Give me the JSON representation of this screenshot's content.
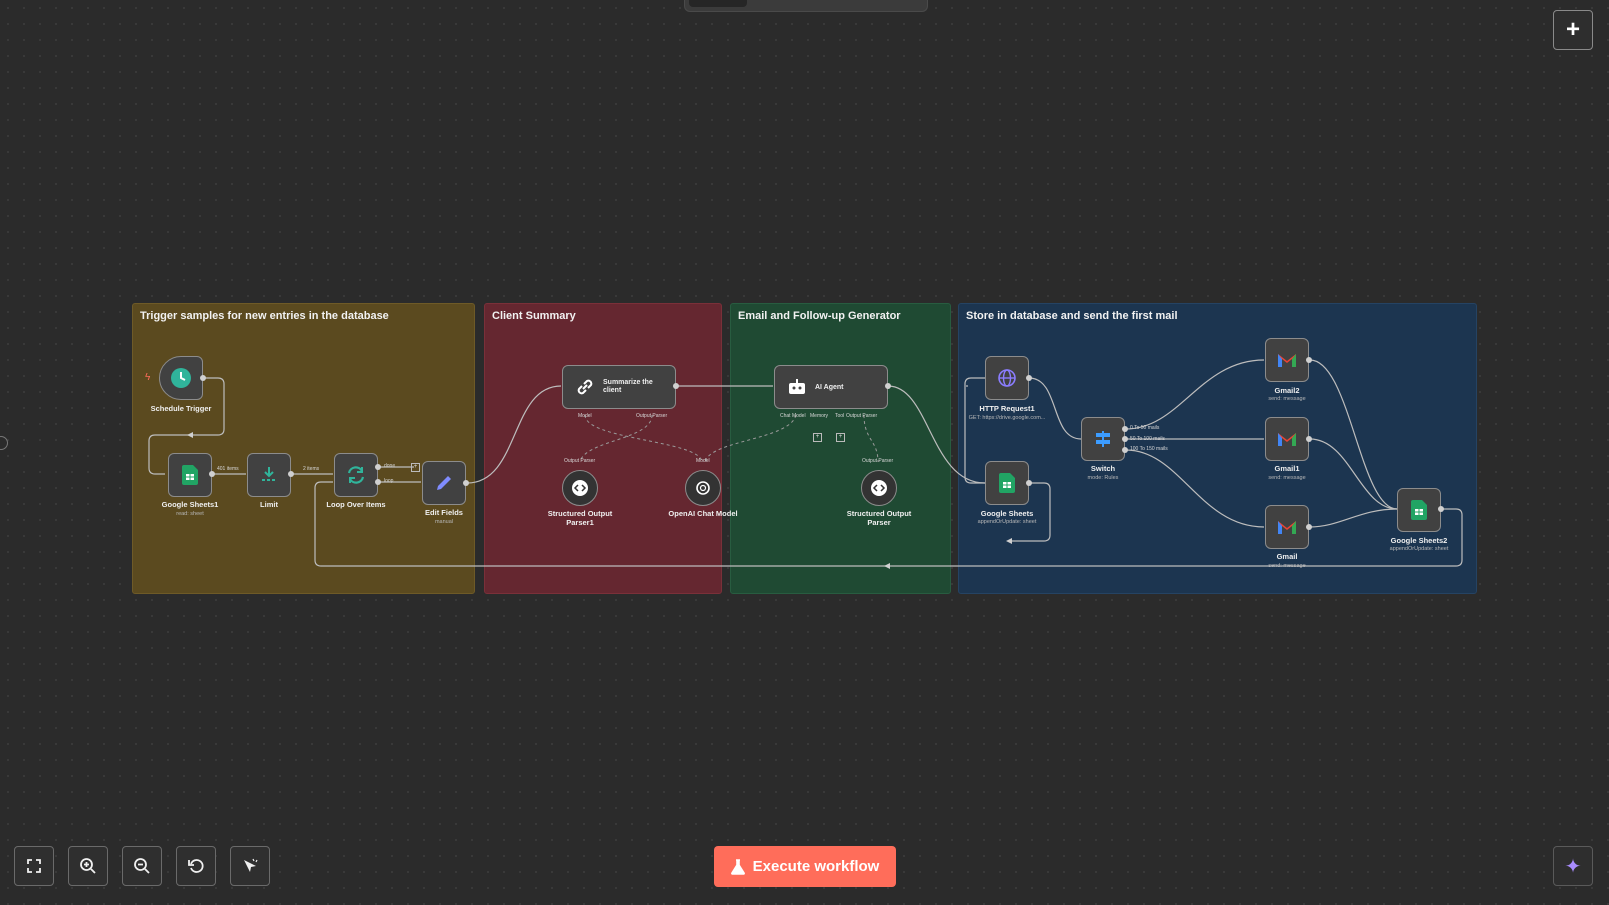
{
  "groups": {
    "g1": "Trigger samples for new entries in the database",
    "g2": "Client Summary",
    "g3": "Email and Follow-up Generator",
    "g4": "Store in database and send the first mail"
  },
  "nodes": {
    "schedule_trigger": {
      "label": "Schedule Trigger"
    },
    "google_sheets1": {
      "label": "Google Sheets1",
      "sub": "read: sheet"
    },
    "limit": {
      "label": "Limit"
    },
    "loop_over_items": {
      "label": "Loop Over Items"
    },
    "edit_fields": {
      "label": "Edit Fields",
      "sub": "manual"
    },
    "summarize_client": {
      "label": "Summarize the client"
    },
    "structured_parser1": {
      "label": "Structured Output Parser1"
    },
    "openai_chat": {
      "label": "OpenAI Chat Model"
    },
    "ai_agent": {
      "label": "AI Agent"
    },
    "structured_parser": {
      "label": "Structured Output Parser"
    },
    "http_request1": {
      "label": "HTTP Request1",
      "sub": "GET: https://drive.google.com..."
    },
    "google_sheets": {
      "label": "Google Sheets",
      "sub": "appendOrUpdate: sheet"
    },
    "switch": {
      "label": "Switch",
      "sub": "mode: Rules"
    },
    "gmail2": {
      "label": "Gmail2",
      "sub": "send: message"
    },
    "gmail1": {
      "label": "Gmail1",
      "sub": "send: message"
    },
    "gmail": {
      "label": "Gmail",
      "sub": "send: message"
    },
    "google_sheets2": {
      "label": "Google Sheets2",
      "sub": "appendOrUpdate: sheet"
    }
  },
  "edge_labels": {
    "items_401": "401 items",
    "items_2": "2 items",
    "done": "done",
    "loop": "loop",
    "model_a": "Model",
    "output_parser_a": "Output Parser",
    "output_parser_b": "Output Parser",
    "model_b": "Model",
    "chat_model": "Chat Model",
    "memory": "Memory",
    "tool": "Tool",
    "output_parser_c": "Output Parser",
    "output_parser_d": "Output Parser",
    "rule1": "0 To 50 mails",
    "rule2": "50 To 100 mails",
    "rule3": "100 To 150 mails"
  },
  "controls": {
    "execute_label": "Execute workflow",
    "fit_icon": "fit-view-icon",
    "zoom_in_icon": "zoom-in-icon",
    "zoom_out_icon": "zoom-out-icon",
    "reset_icon": "reset-zoom-icon",
    "tidy_icon": "tidy-up-icon",
    "add_icon": "plus-icon",
    "ai_icon": "sparkle-icon"
  },
  "colors": {
    "trigger_group": "#5b4a1f",
    "summary_group": "#652730",
    "generator_group": "#1f4a33",
    "store_group": "#1c3550",
    "execute_button": "#ff6d5a",
    "sheets_green": "#21a464",
    "gmail_red": "#ea4335"
  }
}
